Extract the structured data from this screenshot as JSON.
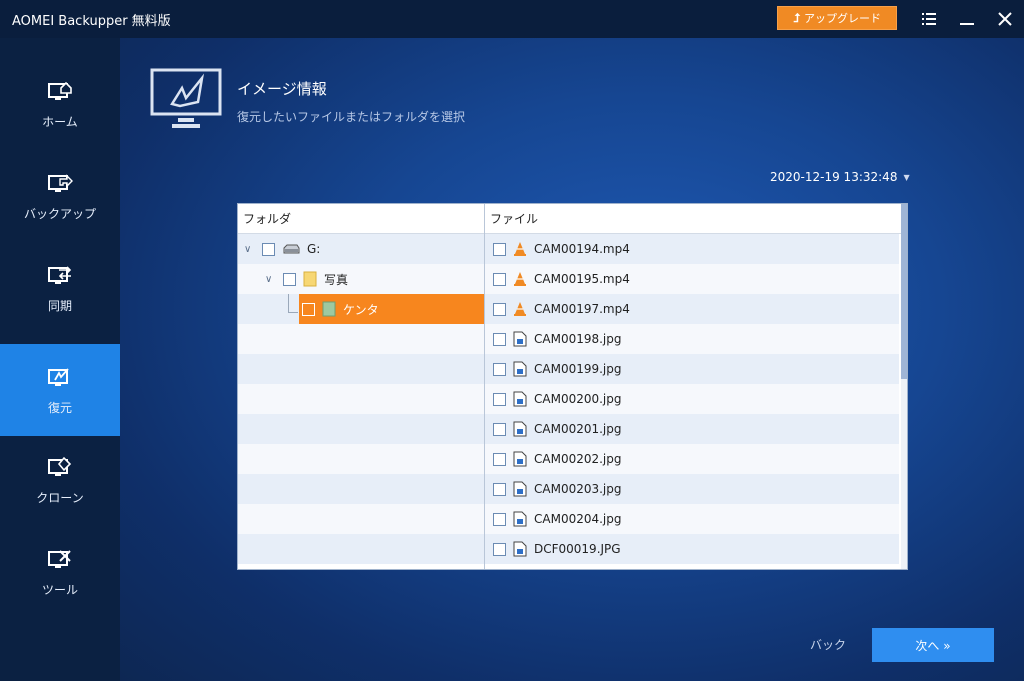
{
  "app": {
    "title": "AOMEI Backupper 無料版",
    "upgrade_label": "アップグレード"
  },
  "sidebar": {
    "items": [
      {
        "label": "ホーム",
        "icon": "home-icon"
      },
      {
        "label": "バックアップ",
        "icon": "backup-icon"
      },
      {
        "label": "同期",
        "icon": "sync-icon"
      },
      {
        "label": "復元",
        "icon": "restore-icon",
        "active": true
      },
      {
        "label": "クローン",
        "icon": "clone-icon"
      },
      {
        "label": "ツール",
        "icon": "tools-icon"
      }
    ]
  },
  "header": {
    "title": "イメージ情報",
    "subtitle": "復元したいファイルまたはフォルダを選択"
  },
  "date_selector": {
    "value": "2020-12-19 13:32:48"
  },
  "browser": {
    "folder_header": "フォルダ",
    "file_header": "ファイル",
    "tree": [
      {
        "label": "G:",
        "icon": "drive-icon"
      },
      {
        "label": "写真",
        "icon": "folder-icon"
      },
      {
        "label": "ケンタ",
        "icon": "folder-icon",
        "selected": true
      }
    ],
    "files": [
      {
        "name": "CAM00194.mp4",
        "icon": "vlc-icon"
      },
      {
        "name": "CAM00195.mp4",
        "icon": "vlc-icon"
      },
      {
        "name": "CAM00197.mp4",
        "icon": "vlc-icon"
      },
      {
        "name": "CAM00198.jpg",
        "icon": "image-file-icon"
      },
      {
        "name": "CAM00199.jpg",
        "icon": "image-file-icon"
      },
      {
        "name": "CAM00200.jpg",
        "icon": "image-file-icon"
      },
      {
        "name": "CAM00201.jpg",
        "icon": "image-file-icon"
      },
      {
        "name": "CAM00202.jpg",
        "icon": "image-file-icon"
      },
      {
        "name": "CAM00203.jpg",
        "icon": "image-file-icon"
      },
      {
        "name": "CAM00204.jpg",
        "icon": "image-file-icon"
      },
      {
        "name": "DCF00019.JPG",
        "icon": "image-file-icon"
      }
    ]
  },
  "footer": {
    "back_label": "バック",
    "next_label": "次へ »"
  },
  "colors": {
    "accent_orange": "#f7861e",
    "accent_blue": "#1f83e6",
    "next_button": "#2f8ef0"
  }
}
